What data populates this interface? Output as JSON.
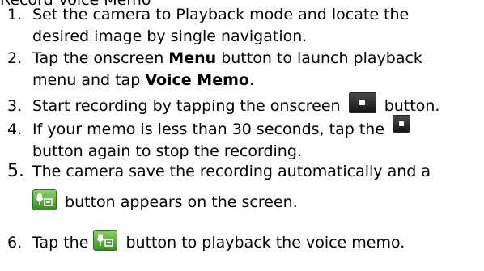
{
  "cutoff_heading": "Record Voice Memo",
  "steps": [
    {
      "num": "1.",
      "line1": "Set the camera to Playback mode and locate the",
      "line2": "desired image by single navigation."
    },
    {
      "num": "2.",
      "line1_a": "Tap the onscreen ",
      "line1_bold": "Menu",
      "line1_b": " button to launch playback",
      "line2_a": "menu and tap ",
      "line2_bold": "Voice Memo",
      "line2_b": "."
    },
    {
      "num": "3.",
      "text_a": "Start recording by tapping the onscreen",
      "text_b": "button.",
      "icon": "record-button-icon"
    },
    {
      "num": "4.",
      "line1_a": "If your memo is less than 30 seconds, tap the",
      "line2": "button again to stop the recording.",
      "icon": "record-button-icon"
    },
    {
      "num": "5.",
      "line1": "The camera save the recording automatically and a",
      "line2": "button appears on the screen.",
      "icon": "voice-memo-icon"
    },
    {
      "num": "6.",
      "text_a": "Tap the",
      "text_b": "button to playback the voice memo.",
      "icon": "voice-memo-icon"
    }
  ]
}
